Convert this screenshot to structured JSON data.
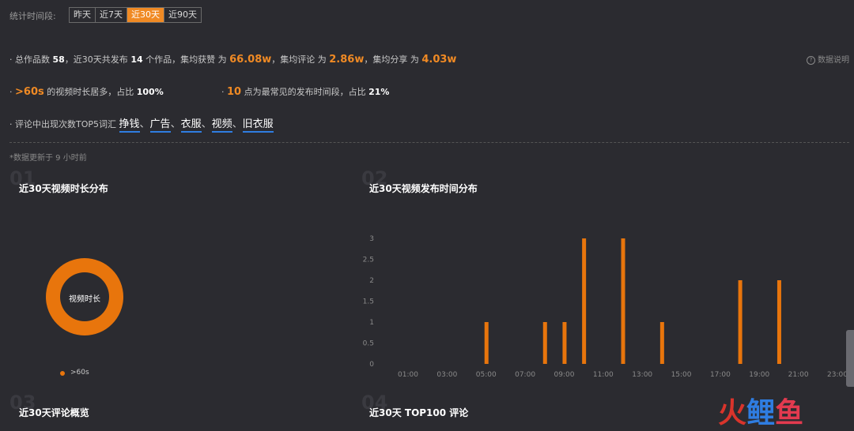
{
  "period": {
    "label": "统计时间段:",
    "tabs": [
      {
        "label": "昨天",
        "active": false
      },
      {
        "label": "近7天",
        "active": false
      },
      {
        "label": "近30天",
        "active": true
      },
      {
        "label": "近90天",
        "active": false
      }
    ]
  },
  "summary": {
    "l1_prefix": "· 总作品数",
    "total_works": "58",
    "l1_mid": "，近30天共发布",
    "published": "14",
    "l1_works": "个作品，",
    "likes_label": "集均获赞 为",
    "likes_value": "66.08w",
    "comments_label": "，集均评论 为",
    "comments_value": "2.86w",
    "shares_label": "，集均分享 为",
    "shares_value": "4.03w",
    "help": "数据说明",
    "l2a_prefix": "·",
    "duration_value": ">60s",
    "l2a_mid": "的视频时长居多，占比",
    "duration_pct": "100%",
    "l2b_prefix": "·",
    "hour_value": "10",
    "l2b_mid": "点为最常见的发布时间段，占比",
    "hour_pct": "21%",
    "l3_prefix": "· 评论中出现次数TOP5词汇",
    "words": [
      "挣钱",
      "广告",
      "衣服",
      "视频",
      "旧衣服"
    ],
    "sep": "、",
    "update_note": "*数据更新于 9 小时前"
  },
  "sections": {
    "s1_num": "01",
    "s1_title": "近30天视频时长分布",
    "s2_num": "02",
    "s2_title": "近30天视频发布时间分布",
    "s3_num": "03",
    "s3_title": "近30天评论概览",
    "s4_num": "04",
    "s4_title": "近30天 TOP100 评论"
  },
  "donut": {
    "center_label": "视频时长",
    "legend": ">60s",
    "color": "#e8750c"
  },
  "chart_data": {
    "type": "bar",
    "title": "近30天视频发布时间分布",
    "x_tick_labels": [
      "01:00",
      "03:00",
      "05:00",
      "07:00",
      "09:00",
      "11:00",
      "13:00",
      "15:00",
      "17:00",
      "19:00",
      "21:00",
      "23:00"
    ],
    "y_ticks": [
      "0",
      "0.5",
      "1",
      "1.5",
      "2",
      "2.5",
      "3"
    ],
    "ylim": [
      0,
      3
    ],
    "x": [
      5,
      8,
      9,
      10,
      12,
      14,
      18,
      20
    ],
    "values": [
      1,
      1,
      1,
      3,
      3,
      1,
      2,
      2
    ],
    "color": "#e8750c"
  },
  "watermark": [
    "火",
    "鲤",
    "鱼"
  ]
}
